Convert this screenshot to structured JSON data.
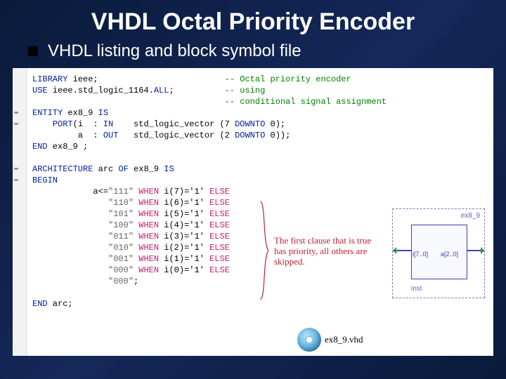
{
  "title": "VHDL Octal Priority Encoder",
  "subtitle": "VHDL listing and block symbol file",
  "code": {
    "lines": [
      {
        "t": "kw",
        "i": 0,
        "segs": [
          {
            "c": "kw-blue",
            "v": "LIBRARY"
          },
          {
            "c": "",
            "v": " ieee;"
          }
        ],
        "cmt": "Octal priority encoder"
      },
      {
        "t": "kw",
        "i": 0,
        "segs": [
          {
            "c": "kw-blue",
            "v": "USE"
          },
          {
            "c": "",
            "v": " ieee.std_logic_1164."
          },
          {
            "c": "kw-blue",
            "v": "ALL"
          },
          {
            "c": "",
            "v": ";"
          }
        ],
        "cmt": "using"
      },
      {
        "t": "sp",
        "i": 0,
        "segs": [],
        "cmt": "conditional signal assignment"
      },
      {
        "t": "kw",
        "i": 0,
        "mark": "-",
        "segs": [
          {
            "c": "kw-blue",
            "v": "ENTITY"
          },
          {
            "c": "",
            "v": " ex8_9 "
          },
          {
            "c": "kw-blue",
            "v": "IS"
          }
        ]
      },
      {
        "t": "kw",
        "i": 1,
        "mark": "-",
        "segs": [
          {
            "c": "kw-blue",
            "v": "PORT"
          },
          {
            "c": "",
            "v": "(i  : "
          },
          {
            "c": "kw-blue",
            "v": "IN"
          },
          {
            "c": "",
            "v": "    std_logic_vector (7 "
          },
          {
            "c": "kw-blue",
            "v": "DOWNTO"
          },
          {
            "c": "",
            "v": " 0);"
          }
        ]
      },
      {
        "t": "kw",
        "i": 1,
        "segs": [
          {
            "c": "",
            "v": "     a  : "
          },
          {
            "c": "kw-blue",
            "v": "OUT"
          },
          {
            "c": "",
            "v": "   std_logic_vector (2 "
          },
          {
            "c": "kw-blue",
            "v": "DOWNTO"
          },
          {
            "c": "",
            "v": " 0));"
          }
        ]
      },
      {
        "t": "kw",
        "i": 0,
        "segs": [
          {
            "c": "kw-blue",
            "v": "END"
          },
          {
            "c": "",
            "v": " ex8_9 ;"
          }
        ]
      },
      {
        "t": "sp",
        "i": 0,
        "segs": []
      },
      {
        "t": "kw",
        "i": 0,
        "mark": "-",
        "segs": [
          {
            "c": "kw-blue",
            "v": "ARCHITECTURE"
          },
          {
            "c": "",
            "v": " arc "
          },
          {
            "c": "kw-blue",
            "v": "OF"
          },
          {
            "c": "",
            "v": " ex8_9 "
          },
          {
            "c": "kw-blue",
            "v": "IS"
          }
        ]
      },
      {
        "t": "kw",
        "i": 0,
        "mark": "-",
        "segs": [
          {
            "c": "kw-blue",
            "v": "BEGIN"
          }
        ]
      },
      {
        "t": "kw",
        "i": 3,
        "segs": [
          {
            "c": "",
            "v": "a<="
          },
          {
            "c": "str",
            "v": "\"111\""
          },
          {
            "c": "",
            "v": " "
          },
          {
            "c": "kw-pink",
            "v": "WHEN"
          },
          {
            "c": "",
            "v": " i(7)='1' "
          },
          {
            "c": "kw-pink",
            "v": "ELSE"
          }
        ]
      },
      {
        "t": "kw",
        "i": 3,
        "segs": [
          {
            "c": "",
            "v": "   "
          },
          {
            "c": "str",
            "v": "\"110\""
          },
          {
            "c": "",
            "v": " "
          },
          {
            "c": "kw-pink",
            "v": "WHEN"
          },
          {
            "c": "",
            "v": " i(6)='1' "
          },
          {
            "c": "kw-pink",
            "v": "ELSE"
          }
        ]
      },
      {
        "t": "kw",
        "i": 3,
        "segs": [
          {
            "c": "",
            "v": "   "
          },
          {
            "c": "str",
            "v": "\"101\""
          },
          {
            "c": "",
            "v": " "
          },
          {
            "c": "kw-pink",
            "v": "WHEN"
          },
          {
            "c": "",
            "v": " i(5)='1' "
          },
          {
            "c": "kw-pink",
            "v": "ELSE"
          }
        ]
      },
      {
        "t": "kw",
        "i": 3,
        "segs": [
          {
            "c": "",
            "v": "   "
          },
          {
            "c": "str",
            "v": "\"100\""
          },
          {
            "c": "",
            "v": " "
          },
          {
            "c": "kw-pink",
            "v": "WHEN"
          },
          {
            "c": "",
            "v": " i(4)='1' "
          },
          {
            "c": "kw-pink",
            "v": "ELSE"
          }
        ]
      },
      {
        "t": "kw",
        "i": 3,
        "segs": [
          {
            "c": "",
            "v": "   "
          },
          {
            "c": "str",
            "v": "\"011\""
          },
          {
            "c": "",
            "v": " "
          },
          {
            "c": "kw-pink",
            "v": "WHEN"
          },
          {
            "c": "",
            "v": " i(3)='1' "
          },
          {
            "c": "kw-pink",
            "v": "ELSE"
          }
        ]
      },
      {
        "t": "kw",
        "i": 3,
        "segs": [
          {
            "c": "",
            "v": "   "
          },
          {
            "c": "str",
            "v": "\"010\""
          },
          {
            "c": "",
            "v": " "
          },
          {
            "c": "kw-pink",
            "v": "WHEN"
          },
          {
            "c": "",
            "v": " i(2)='1' "
          },
          {
            "c": "kw-pink",
            "v": "ELSE"
          }
        ]
      },
      {
        "t": "kw",
        "i": 3,
        "segs": [
          {
            "c": "",
            "v": "   "
          },
          {
            "c": "str",
            "v": "\"001\""
          },
          {
            "c": "",
            "v": " "
          },
          {
            "c": "kw-pink",
            "v": "WHEN"
          },
          {
            "c": "",
            "v": " i(1)='1' "
          },
          {
            "c": "kw-pink",
            "v": "ELSE"
          }
        ]
      },
      {
        "t": "kw",
        "i": 3,
        "segs": [
          {
            "c": "",
            "v": "   "
          },
          {
            "c": "str",
            "v": "\"000\""
          },
          {
            "c": "",
            "v": " "
          },
          {
            "c": "kw-pink",
            "v": "WHEN"
          },
          {
            "c": "",
            "v": " i(0)='1' "
          },
          {
            "c": "kw-pink",
            "v": "ELSE"
          }
        ]
      },
      {
        "t": "kw",
        "i": 3,
        "segs": [
          {
            "c": "",
            "v": "   "
          },
          {
            "c": "str",
            "v": "\"000\""
          },
          {
            "c": "",
            "v": ";"
          }
        ]
      },
      {
        "t": "sp",
        "i": 0,
        "segs": []
      },
      {
        "t": "kw",
        "i": 0,
        "segs": [
          {
            "c": "kw-blue",
            "v": "END"
          },
          {
            "c": "",
            "v": " arc;"
          }
        ]
      }
    ],
    "comment_col": 38
  },
  "annotation": "The first clause that is true has priority, all others are skipped.",
  "disc_label": "ex8_9.vhd",
  "symbol": {
    "name": "ex8_9",
    "port_in": "i[7..0]",
    "port_out": "a[2..0]",
    "inst": "inst"
  }
}
